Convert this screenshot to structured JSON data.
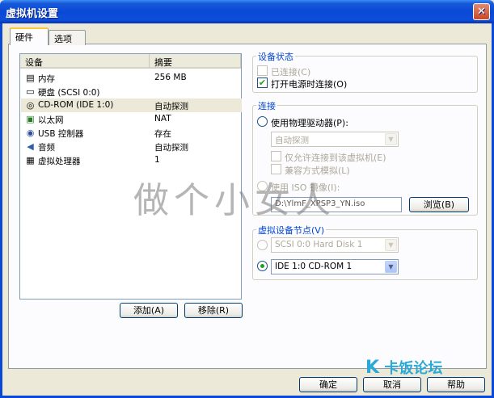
{
  "window": {
    "title": "虚拟机设置",
    "close_glyph": "✕"
  },
  "tabs": [
    {
      "label": "硬件",
      "active": true
    },
    {
      "label": "选项",
      "active": false
    }
  ],
  "device_list": {
    "columns": [
      "设备",
      "摘要"
    ],
    "rows": [
      {
        "icon": "memory-icon",
        "glyph": "▤",
        "device": "内存",
        "summary": "256 MB",
        "selected": false
      },
      {
        "icon": "hard-disk-icon",
        "glyph": "▭",
        "device": "硬盘 (SCSI 0:0)",
        "summary": "",
        "selected": false
      },
      {
        "icon": "cdrom-icon",
        "glyph": "◎",
        "device": "CD-ROM (IDE 1:0)",
        "summary": "自动探测",
        "selected": true
      },
      {
        "icon": "ethernet-icon",
        "glyph": "▣",
        "device": "以太网",
        "summary": "NAT",
        "selected": false
      },
      {
        "icon": "usb-icon",
        "glyph": "◉",
        "device": "USB 控制器",
        "summary": "存在",
        "selected": false
      },
      {
        "icon": "audio-icon",
        "glyph": "◀",
        "device": "音频",
        "summary": "自动探测",
        "selected": false
      },
      {
        "icon": "cpu-icon",
        "glyph": "▦",
        "device": "虚拟处理器",
        "summary": "1",
        "selected": false
      }
    ],
    "add_label": "添加(A)",
    "remove_label": "移除(R)"
  },
  "device_status": {
    "title": "设备状态",
    "connected_label": "已连接(C)",
    "connected_checked": false,
    "connect_on_power_label": "打开电源时连接(O)",
    "connect_on_power_checked": true
  },
  "connection": {
    "title": "连接",
    "physical_label": "使用物理驱动器(P):",
    "physical_value": "自动探测",
    "allow_vm_label": "仅允许连接到该虚拟机(E)",
    "legacy_label": "兼容方式模拟(L)",
    "iso_label": "使用 ISO 镜像(I):",
    "iso_value": "D:\\YlmF_XPSP3_YN.iso",
    "browse_label": "浏览(B)"
  },
  "virtual_node": {
    "title": "虚拟设备节点(V)",
    "scsi_value": "SCSI 0:0   Hard Disk 1",
    "ide_value": "IDE 1:0   CD-ROM 1"
  },
  "footer": {
    "ok_label": "确定",
    "cancel_label": "取消",
    "help_label": "帮助"
  },
  "overlay": {
    "watermark": "做个小女人",
    "brand": "卡饭论坛"
  },
  "colors": {
    "title_bar": "#0a48d6",
    "group_title": "#0046d5",
    "check": "#21a121",
    "brand": "#2aa9d8"
  }
}
